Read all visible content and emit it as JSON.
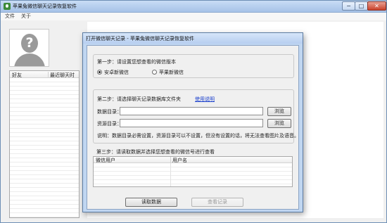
{
  "main_window": {
    "title": "苹果兔微信聊天记录恢复软件",
    "controls": {
      "minimize": "−",
      "maximize": "□",
      "close": "✕"
    },
    "menu": [
      "文件",
      "关于"
    ],
    "friend_list": {
      "columns": [
        "好友",
        "最近聊天时间"
      ]
    }
  },
  "dialog": {
    "title": "打开微信聊天记录 - 苹果兔微信聊天记录恢复软件",
    "step1": {
      "label": "第一步：请设置您想查看的微信版本",
      "options": [
        "安卓新微信",
        "苹果新微信"
      ],
      "selected": 0
    },
    "step2": {
      "label": "第二步：请选择聊天记录数据库文件夹",
      "help_link": "使用说明",
      "data_dir_label": "数据目录：",
      "data_dir_value": "",
      "res_dir_label": "资源目录：",
      "res_dir_value": "",
      "browse": "浏览",
      "note": "说明：数据目录必需设置，资源目录可以不设置，但没有设置的话，将无法查看图片及语音。"
    },
    "step3": {
      "label": "第三步：请读取数据并选择您想查看的微信号进行查看",
      "columns": [
        "微信用户",
        "用户名"
      ]
    },
    "buttons": {
      "read": "读取数据",
      "view": "查看记录"
    }
  }
}
